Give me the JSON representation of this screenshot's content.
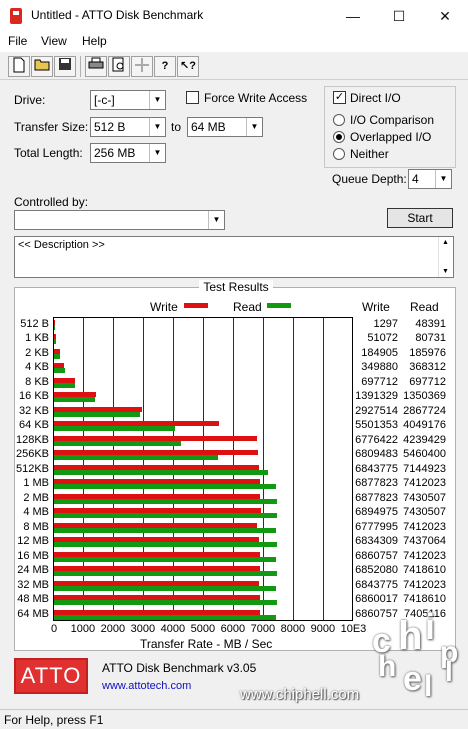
{
  "window": {
    "title": "Untitled - ATTO Disk Benchmark",
    "minimize_glyph": "—",
    "maximize_glyph": "☐",
    "close_glyph": "✕"
  },
  "menu": {
    "file": "File",
    "view": "View",
    "help": "Help"
  },
  "toolbar": {
    "buttons": [
      "new-icon",
      "open-icon",
      "save-icon",
      "print-icon",
      "print-preview-icon",
      "move-icon",
      "help-icon",
      "context-help-icon"
    ]
  },
  "settings": {
    "drive_label": "Drive:",
    "drive_value": "[-c-]",
    "transfer_size_label": "Transfer Size:",
    "transfer_from": "512 B",
    "to_label": "to",
    "transfer_to": "64 MB",
    "total_length_label": "Total Length:",
    "total_length_value": "256 MB",
    "force_write_label": "Force Write Access",
    "force_write_checked": false,
    "direct_io_label": "Direct I/O",
    "direct_io_checked": true,
    "io_comparison_label": "I/O Comparison",
    "overlapped_io_label": "Overlapped I/O",
    "neither_label": "Neither",
    "selected_mode": "Overlapped I/O",
    "queue_depth_label": "Queue Depth:",
    "queue_depth_value": "4",
    "controlled_by_label": "Controlled by:",
    "controlled_by_value": "",
    "start_label": "Start",
    "description": "<< Description >>"
  },
  "results": {
    "title": "Test Results",
    "legend_write": "Write",
    "legend_read": "Read",
    "col_write": "Write",
    "col_read": "Read",
    "write_color": "#dd1111",
    "read_color": "#119911",
    "x_axis_title": "Transfer Rate - MB / Sec",
    "x_ticks": [
      "0",
      "1000",
      "2000",
      "3000",
      "4000",
      "5000",
      "6000",
      "7000",
      "8000",
      "9000",
      "10E3"
    ]
  },
  "chart_data": {
    "type": "bar",
    "orientation": "horizontal",
    "categories": [
      "512 B",
      "1 KB",
      "2 KB",
      "4 KB",
      "8 KB",
      "16 KB",
      "32 KB",
      "64 KB",
      "128KB",
      "256KB",
      "512KB",
      "1 MB",
      "2 MB",
      "4 MB",
      "8 MB",
      "12 MB",
      "16 MB",
      "24 MB",
      "32 MB",
      "48 MB",
      "64 MB"
    ],
    "series": [
      {
        "name": "Write",
        "values": [
          1297,
          51072,
          184905,
          349880,
          697712,
          1391329,
          2927514,
          5501353,
          6776422,
          6809483,
          6843775,
          6877823,
          6877823,
          6894975,
          6777995,
          6834309,
          6860757,
          6852080,
          6843775,
          6860017,
          6860757
        ]
      },
      {
        "name": "Read",
        "values": [
          48391,
          80731,
          185976,
          368312,
          697712,
          1350369,
          2867724,
          4049176,
          4239429,
          5460400,
          7144923,
          7412023,
          7430507,
          7430507,
          7412023,
          7437064,
          7412023,
          7418610,
          7412023,
          7418610,
          7405116
        ]
      }
    ],
    "xlabel": "Transfer Rate - MB / Sec",
    "xlim": [
      0,
      10000
    ],
    "grid": true,
    "legend": "top"
  },
  "footer": {
    "logo_text": "ATTO",
    "app_version": "ATTO Disk Benchmark v3.05",
    "website": "www.attotech.com",
    "watermark_site": "www.chiphell.com",
    "watermark_chars": [
      "c",
      "h",
      "i",
      "p",
      "h",
      "e",
      "l",
      "l"
    ]
  },
  "status": {
    "text": "For Help, press F1"
  }
}
